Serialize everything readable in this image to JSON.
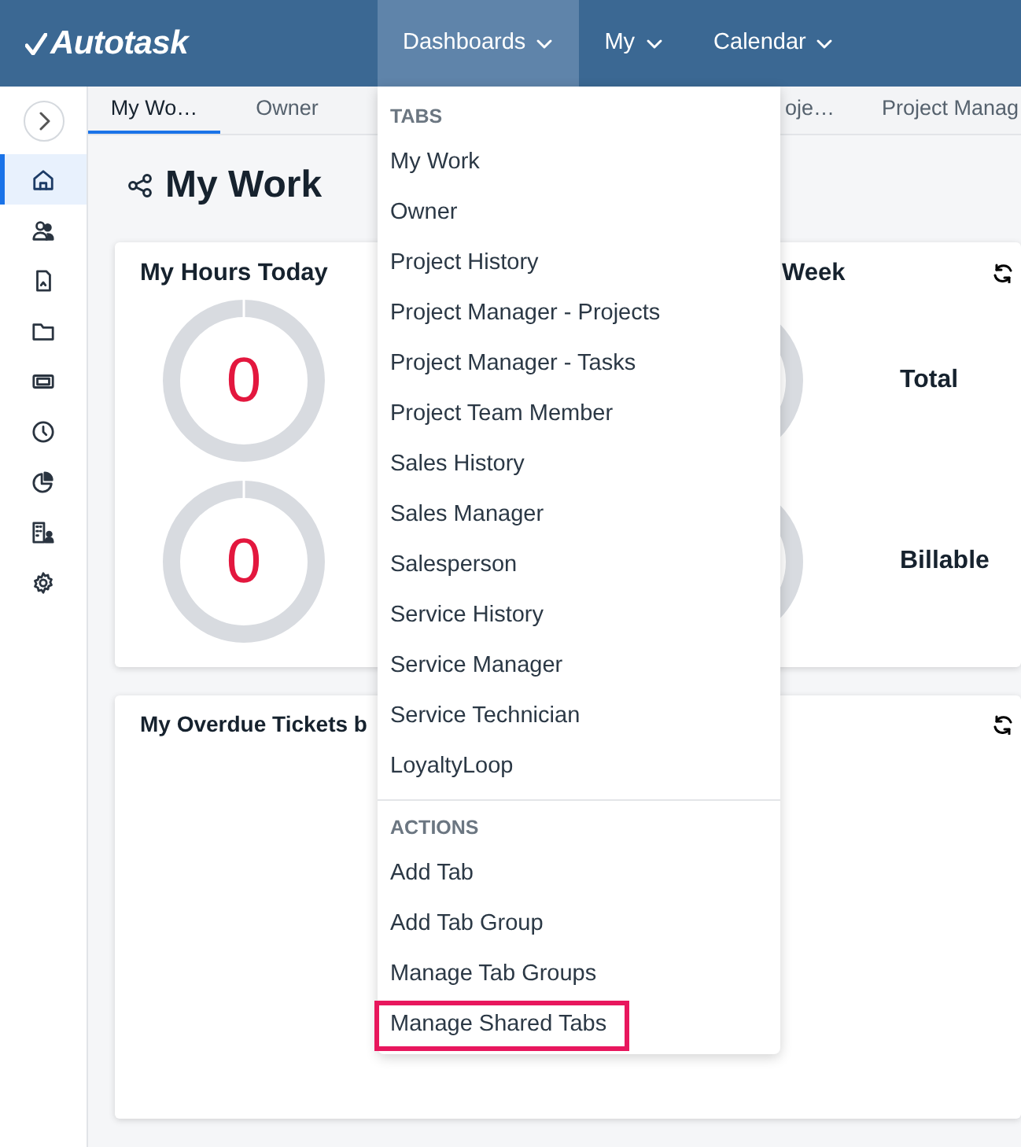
{
  "header": {
    "logo": "Autotask",
    "nav": [
      {
        "label": "Dashboards",
        "selected": true
      },
      {
        "label": "My",
        "selected": false
      },
      {
        "label": "Calendar",
        "selected": false
      }
    ]
  },
  "sidebar": {
    "items": [
      {
        "selected": true
      },
      {
        "selected": false
      },
      {
        "selected": false
      },
      {
        "selected": false
      },
      {
        "selected": false
      },
      {
        "selected": false
      },
      {
        "selected": false
      },
      {
        "selected": false
      },
      {
        "selected": false
      }
    ]
  },
  "tabs": [
    {
      "label": "My Wo…",
      "selected": true
    },
    {
      "label": "Owner",
      "selected": false
    },
    {
      "label": "oje…",
      "selected": false
    },
    {
      "label": "Project Manag",
      "selected": false
    }
  ],
  "page_title": "My Work",
  "cards": [
    {
      "kind": "gauges",
      "title": "My Hours Today",
      "gauges": [
        {
          "value": "0"
        },
        {
          "value": "0"
        }
      ]
    },
    {
      "kind": "labeled_gauges",
      "title": "Week",
      "refresh": true,
      "labels": [
        "Total",
        "Billable"
      ]
    },
    {
      "kind": "empty",
      "title": "My Overdue Tickets b",
      "refresh": true
    }
  ],
  "menu": {
    "sections": [
      {
        "heading": "TABS",
        "items": [
          {
            "label": "My Work",
            "highlighted": false
          },
          {
            "label": "Owner",
            "highlighted": false
          },
          {
            "label": "Project History",
            "highlighted": false
          },
          {
            "label": "Project Manager - Projects",
            "highlighted": false
          },
          {
            "label": "Project Manager - Tasks",
            "highlighted": false
          },
          {
            "label": "Project Team Member",
            "highlighted": false
          },
          {
            "label": "Sales History",
            "highlighted": false
          },
          {
            "label": "Sales Manager",
            "highlighted": false
          },
          {
            "label": "Salesperson",
            "highlighted": false
          },
          {
            "label": "Service History",
            "highlighted": false
          },
          {
            "label": "Service Manager",
            "highlighted": false
          },
          {
            "label": "Service Technician",
            "highlighted": false
          },
          {
            "label": "LoyaltyLoop",
            "highlighted": false
          }
        ]
      },
      {
        "heading": "ACTIONS",
        "items": [
          {
            "label": "Add Tab",
            "highlighted": false
          },
          {
            "label": "Add Tab Group",
            "highlighted": false
          },
          {
            "label": "Manage Tab Groups",
            "highlighted": false
          },
          {
            "label": "Manage Shared Tabs",
            "highlighted": true
          }
        ]
      }
    ]
  }
}
